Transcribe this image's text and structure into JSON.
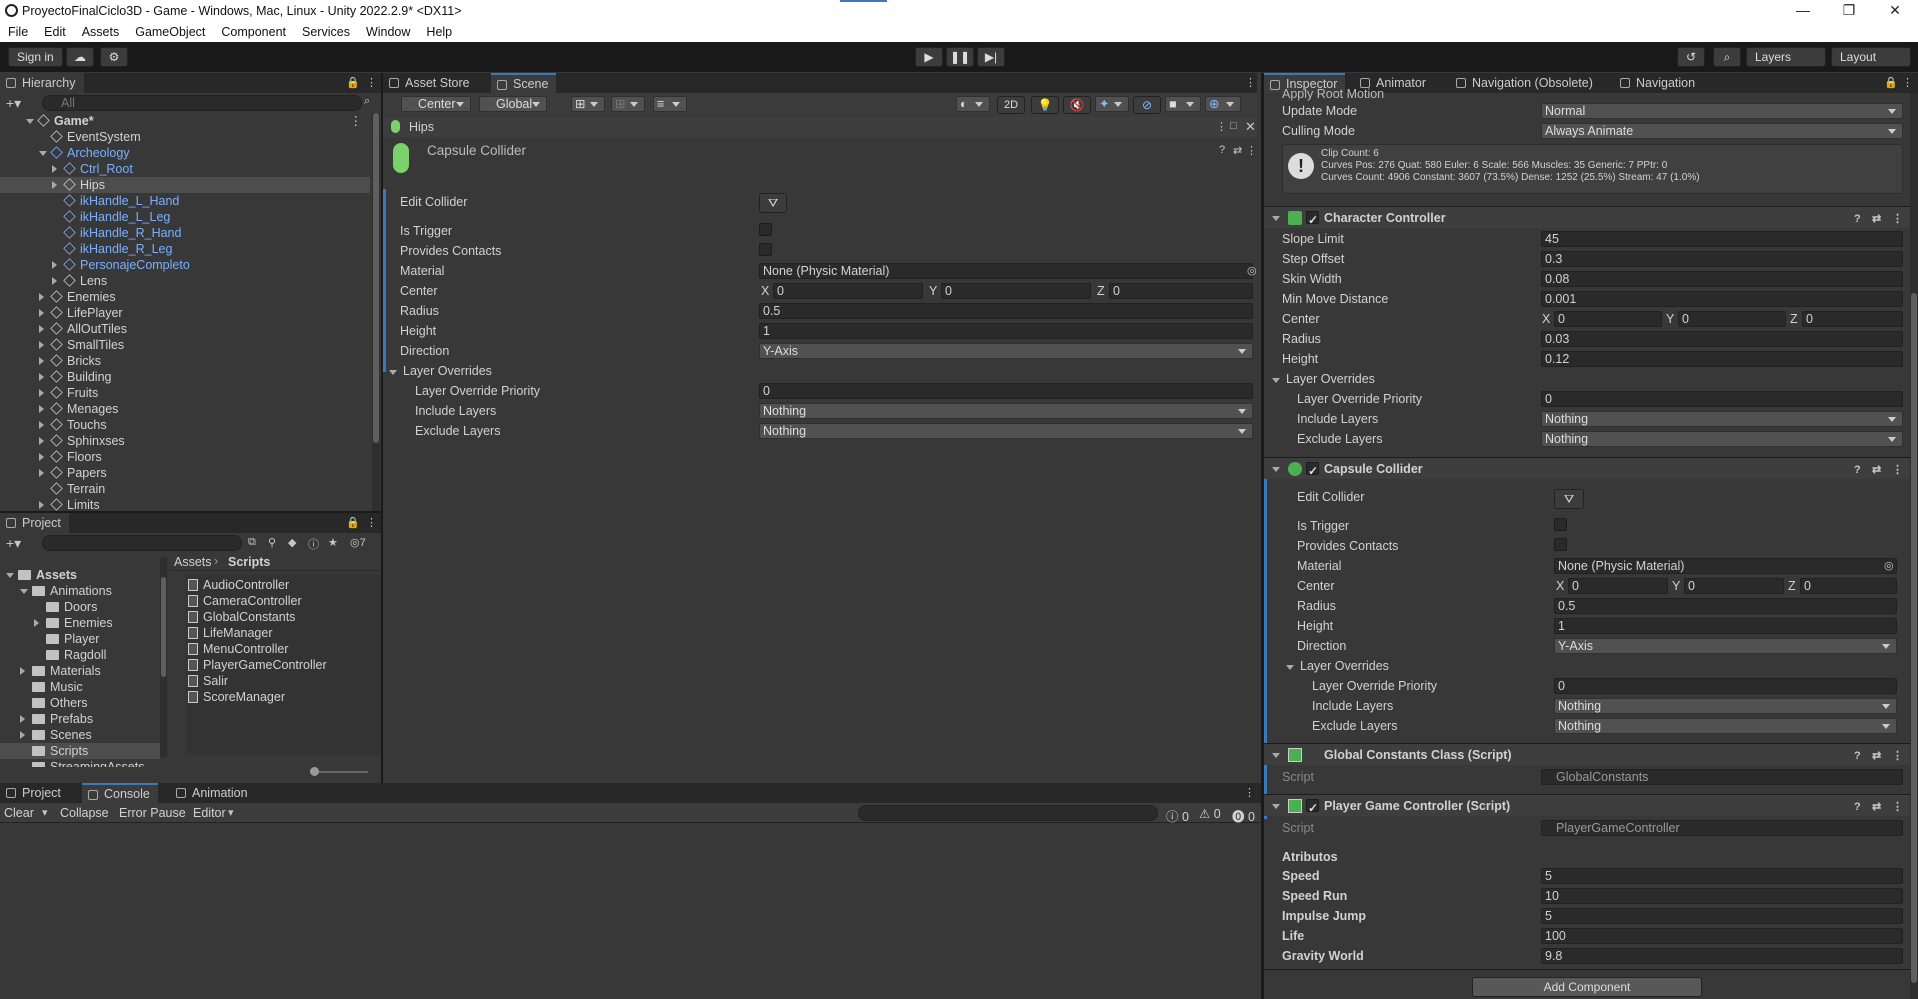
{
  "window": {
    "title": "ProyectoFinalCiclo3D - Game - Windows, Mac, Linux - Unity 2022.2.9* <DX11>",
    "controls": [
      "—",
      "❐",
      "✕"
    ]
  },
  "menu": [
    "File",
    "Edit",
    "Assets",
    "GameObject",
    "Component",
    "Services",
    "Window",
    "Help"
  ],
  "toolbar": {
    "sign_in": "Sign in",
    "layers": "Layers",
    "layout": "Layout"
  },
  "hierarchy": {
    "tab": "Hierarchy",
    "search_placeholder": "All",
    "items": [
      {
        "label": "Game*",
        "depth": 0,
        "arrow": "down",
        "blue": false,
        "icon": "unity-scene-icon"
      },
      {
        "label": "EventSystem",
        "depth": 1,
        "arrow": "",
        "blue": false,
        "icon": "gameobject-icon"
      },
      {
        "label": "Archeology",
        "depth": 1,
        "arrow": "down",
        "blue": true,
        "icon": "prefab-icon"
      },
      {
        "label": "Ctrl_Root",
        "depth": 2,
        "arrow": "right",
        "blue": true,
        "icon": "gameobject-icon"
      },
      {
        "label": "Hips",
        "depth": 2,
        "arrow": "right",
        "blue": false,
        "icon": "gameobject-icon",
        "selected": true
      },
      {
        "label": "ikHandle_L_Hand",
        "depth": 2,
        "arrow": "",
        "blue": true,
        "icon": "gameobject-icon"
      },
      {
        "label": "ikHandle_L_Leg",
        "depth": 2,
        "arrow": "",
        "blue": true,
        "icon": "gameobject-icon"
      },
      {
        "label": "ikHandle_R_Hand",
        "depth": 2,
        "arrow": "",
        "blue": true,
        "icon": "gameobject-icon"
      },
      {
        "label": "ikHandle_R_Leg",
        "depth": 2,
        "arrow": "",
        "blue": true,
        "icon": "gameobject-icon"
      },
      {
        "label": "PersonajeCompleto",
        "depth": 2,
        "arrow": "right",
        "blue": true,
        "icon": "gameobject-icon"
      },
      {
        "label": "Lens",
        "depth": 2,
        "arrow": "right",
        "blue": false,
        "icon": "gameobject-icon"
      },
      {
        "label": "Enemies",
        "depth": 1,
        "arrow": "right",
        "blue": false,
        "icon": "gameobject-icon"
      },
      {
        "label": "LifePlayer",
        "depth": 1,
        "arrow": "right",
        "blue": false,
        "icon": "gameobject-icon"
      },
      {
        "label": "AllOutTiles",
        "depth": 1,
        "arrow": "right",
        "blue": false,
        "icon": "gameobject-icon"
      },
      {
        "label": "SmallTiles",
        "depth": 1,
        "arrow": "right",
        "blue": false,
        "icon": "gameobject-icon"
      },
      {
        "label": "Bricks",
        "depth": 1,
        "arrow": "right",
        "blue": false,
        "icon": "gameobject-icon"
      },
      {
        "label": "Building",
        "depth": 1,
        "arrow": "right",
        "blue": false,
        "icon": "gameobject-icon"
      },
      {
        "label": "Fruits",
        "depth": 1,
        "arrow": "right",
        "blue": false,
        "icon": "gameobject-icon"
      },
      {
        "label": "Menages",
        "depth": 1,
        "arrow": "right",
        "blue": false,
        "icon": "gameobject-icon"
      },
      {
        "label": "Touchs",
        "depth": 1,
        "arrow": "right",
        "blue": false,
        "icon": "gameobject-icon"
      },
      {
        "label": "Sphinxses",
        "depth": 1,
        "arrow": "right",
        "blue": false,
        "icon": "gameobject-icon"
      },
      {
        "label": "Floors",
        "depth": 1,
        "arrow": "right",
        "blue": false,
        "icon": "gameobject-icon"
      },
      {
        "label": "Papers",
        "depth": 1,
        "arrow": "right",
        "blue": false,
        "icon": "gameobject-icon"
      },
      {
        "label": "Terrain",
        "depth": 1,
        "arrow": "",
        "blue": false,
        "icon": "gameobject-icon"
      },
      {
        "label": "Limits",
        "depth": 1,
        "arrow": "right",
        "blue": false,
        "icon": "gameobject-icon"
      }
    ]
  },
  "project": {
    "tab": "Project",
    "hidden_count": "7",
    "breadcrumb": [
      "Assets",
      "Scripts"
    ],
    "tree": [
      {
        "label": "Assets",
        "depth": 0,
        "arrow": "down",
        "bold": true
      },
      {
        "label": "Animations",
        "depth": 1,
        "arrow": "down"
      },
      {
        "label": "Doors",
        "depth": 2,
        "arrow": ""
      },
      {
        "label": "Enemies",
        "depth": 2,
        "arrow": "right"
      },
      {
        "label": "Player",
        "depth": 2,
        "arrow": ""
      },
      {
        "label": "Ragdoll",
        "depth": 2,
        "arrow": ""
      },
      {
        "label": "Materials",
        "depth": 1,
        "arrow": "right"
      },
      {
        "label": "Music",
        "depth": 1,
        "arrow": ""
      },
      {
        "label": "Others",
        "depth": 1,
        "arrow": ""
      },
      {
        "label": "Prefabs",
        "depth": 1,
        "arrow": "right"
      },
      {
        "label": "Scenes",
        "depth": 1,
        "arrow": "right"
      },
      {
        "label": "Scripts",
        "depth": 1,
        "arrow": "",
        "selected": true
      },
      {
        "label": "StreamingAssets",
        "depth": 1,
        "arrow": ""
      }
    ],
    "files": [
      "AudioController",
      "CameraController",
      "GlobalConstants",
      "LifeManager",
      "MenuController",
      "PlayerGameController",
      "Salir",
      "ScoreManager"
    ]
  },
  "scene": {
    "tabs": [
      "Asset Store",
      "Scene"
    ],
    "pivot": "Center",
    "space": "Global",
    "mode_2d": "2D"
  },
  "hips_panel": {
    "title": "Hips",
    "component": "Capsule Collider",
    "fields": {
      "edit_collider": "Edit Collider",
      "is_trigger": "Is Trigger",
      "provides_contacts": "Provides Contacts",
      "material": "Material",
      "material_value": "None (Physic Material)",
      "center": "Center",
      "center_x": "0",
      "center_y": "0",
      "center_z": "0",
      "radius": "Radius",
      "radius_value": "0.5",
      "height": "Height",
      "height_value": "1",
      "direction": "Direction",
      "direction_value": "Y-Axis",
      "layer_overrides": "Layer Overrides",
      "priority": "Layer Override Priority",
      "priority_value": "0",
      "include": "Include Layers",
      "include_value": "Nothing",
      "exclude": "Exclude Layers",
      "exclude_value": "Nothing"
    }
  },
  "console": {
    "tabs": [
      "Project",
      "Console",
      "Animation"
    ],
    "toolbar": [
      "Clear",
      "Collapse",
      "Error Pause",
      "Editor"
    ],
    "counts": [
      "0",
      "0",
      "0"
    ]
  },
  "inspector": {
    "tabs": [
      "Inspector",
      "Animator",
      "Navigation (Obsolete)",
      "Navigation"
    ],
    "animator": {
      "apply_root_motion": "Apply Root Motion",
      "update_mode": "Update Mode",
      "update_mode_value": "Normal",
      "culling_mode": "Culling Mode",
      "culling_mode_value": "Always Animate",
      "info1": "Clip Count: 6",
      "info2": "Curves Pos: 276 Quat: 580 Euler: 6 Scale: 566 Muscles: 35 Generic: 7 PPtr: 0",
      "info3": "Curves Count: 4906 Constant: 3607 (73.5%) Dense: 1252 (25.5%) Stream: 47 (1.0%)"
    },
    "character_controller": {
      "title": "Character Controller",
      "slope_limit": "Slope Limit",
      "slope_limit_value": "45",
      "step_offset": "Step Offset",
      "step_offset_value": "0.3",
      "skin_width": "Skin Width",
      "skin_width_value": "0.08",
      "min_move": "Min Move Distance",
      "min_move_value": "0.001",
      "center": "Center",
      "cx": "0",
      "cy": "0",
      "cz": "0",
      "radius": "Radius",
      "radius_value": "0.03",
      "height": "Height",
      "height_value": "0.12",
      "layer_overrides": "Layer Overrides",
      "priority": "Layer Override Priority",
      "priority_value": "0",
      "include": "Include Layers",
      "include_value": "Nothing",
      "exclude": "Exclude Layers",
      "exclude_value": "Nothing"
    },
    "capsule_collider": {
      "title": "Capsule Collider",
      "edit_collider": "Edit Collider",
      "is_trigger": "Is Trigger",
      "provides_contacts": "Provides Contacts",
      "material": "Material",
      "material_value": "None (Physic Material)",
      "center": "Center",
      "cx": "0",
      "cy": "0",
      "cz": "0",
      "radius": "Radius",
      "radius_value": "0.5",
      "height": "Height",
      "height_value": "1",
      "direction": "Direction",
      "direction_value": "Y-Axis",
      "layer_overrides": "Layer Overrides",
      "priority": "Layer Override Priority",
      "priority_value": "0",
      "include": "Include Layers",
      "include_value": "Nothing",
      "exclude": "Exclude Layers",
      "exclude_value": "Nothing"
    },
    "global_constants": {
      "title": "Global Constants Class (Script)",
      "script": "Script",
      "script_value": "GlobalConstants"
    },
    "player_controller": {
      "title": "Player Game Controller (Script)",
      "script": "Script",
      "script_value": "PlayerGameController",
      "section": "Atributos",
      "speed": "Speed",
      "speed_value": "5",
      "speed_run": "Speed Run",
      "speed_run_value": "10",
      "impulse_jump": "Impulse Jump",
      "impulse_jump_value": "5",
      "life": "Life",
      "life_value": "100",
      "gravity": "Gravity World",
      "gravity_value": "9.8"
    },
    "add_component": "Add Component"
  },
  "labels": {
    "x": "X",
    "y": "Y",
    "z": "Z"
  }
}
